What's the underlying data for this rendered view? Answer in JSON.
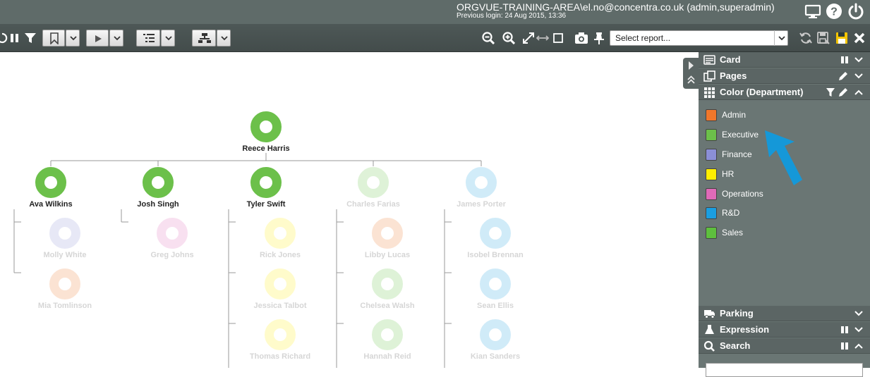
{
  "header": {
    "session_user": "ORGVUE-TRAINING-AREA\\el.no@concentra.co.uk (admin,superadmin)",
    "previous_login": "Previous login: 24 Aug 2015, 13:36"
  },
  "toolbar": {
    "report_select_placeholder": "Select report..."
  },
  "org_chart": {
    "nodes": [
      {
        "id": "reece",
        "name": "Reece Harris",
        "department": "Executive",
        "faded": false
      },
      {
        "id": "ava",
        "name": "Ava Wilkins",
        "department": "Executive",
        "faded": false
      },
      {
        "id": "josh",
        "name": "Josh Singh",
        "department": "Executive",
        "faded": false
      },
      {
        "id": "tyler",
        "name": "Tyler Swift",
        "department": "Executive",
        "faded": false
      },
      {
        "id": "charles",
        "name": "Charles Farias",
        "department": "Sales",
        "faded": true
      },
      {
        "id": "james",
        "name": "James Porter",
        "department": "R&D",
        "faded": true
      },
      {
        "id": "molly",
        "name": "Molly White",
        "department": "Finance",
        "faded": true
      },
      {
        "id": "mia",
        "name": "Mia Tomlinson",
        "department": "Admin",
        "faded": true
      },
      {
        "id": "greg",
        "name": "Greg Johns",
        "department": "Operations",
        "faded": true
      },
      {
        "id": "rick",
        "name": "Rick Jones",
        "department": "HR",
        "faded": true
      },
      {
        "id": "jessica",
        "name": "Jessica Talbot",
        "department": "HR",
        "faded": true
      },
      {
        "id": "thomas",
        "name": "Thomas Richard",
        "department": "HR",
        "faded": true
      },
      {
        "id": "libby",
        "name": "Libby Lucas",
        "department": "Admin",
        "faded": true
      },
      {
        "id": "chelsea",
        "name": "Chelsea Walsh",
        "department": "Sales",
        "faded": true
      },
      {
        "id": "hannah",
        "name": "Hannah Reid",
        "department": "Sales",
        "faded": true
      },
      {
        "id": "isobel",
        "name": "Isobel Brennan",
        "department": "R&D",
        "faded": true
      },
      {
        "id": "sean",
        "name": "Sean Ellis",
        "department": "R&D",
        "faded": true
      },
      {
        "id": "kian",
        "name": "Kian Sanders",
        "department": "R&D",
        "faded": true
      }
    ]
  },
  "panel": {
    "sections": {
      "card": "Card",
      "pages": "Pages",
      "color": "Color (Department)",
      "parking": "Parking",
      "expression": "Expression",
      "search": "Search"
    },
    "legend": [
      {
        "label": "Admin",
        "color": "#f0772b"
      },
      {
        "label": "Executive",
        "color": "#6cc04a"
      },
      {
        "label": "Finance",
        "color": "#8b8fd6"
      },
      {
        "label": "HR",
        "color": "#ffee00"
      },
      {
        "label": "Operations",
        "color": "#e06ab8"
      },
      {
        "label": "R&D",
        "color": "#1b9ee0"
      },
      {
        "label": "Sales",
        "color": "#5ebf3e"
      }
    ]
  },
  "colors": {
    "header_bg": "#5f6b69",
    "panel_bg": "#6a7674",
    "cursor": "#1598d8"
  },
  "icons": [
    "monitor-icon",
    "help-icon",
    "power-icon",
    "refresh-icon",
    "pause-icon",
    "filter-icon",
    "bookmark-icon",
    "play-icon",
    "list-icon",
    "hierarchy-icon",
    "zoom-out-icon",
    "zoom-in-icon",
    "expand-icon",
    "fit-width-icon",
    "square-icon",
    "camera-icon",
    "pin-icon",
    "save-as-icon",
    "save-icon",
    "close-icon",
    "card-icon",
    "pages-icon",
    "grid-icon",
    "truck-icon",
    "flask-icon",
    "search-icon"
  ]
}
